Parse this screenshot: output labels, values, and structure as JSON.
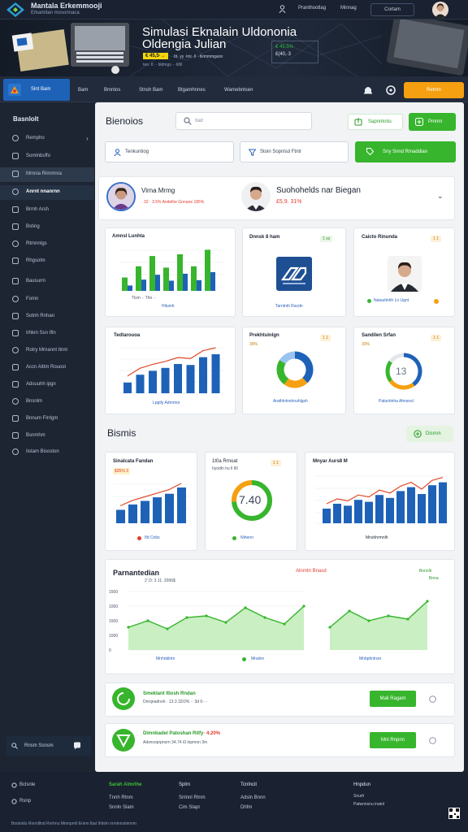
{
  "topbar": {
    "brand": "Mantala Erkemmooji",
    "brand_sub": "Erkamitan mosonnaca",
    "links": [
      "Pranthootlag",
      "Minnag"
    ],
    "search_btn": "Cortam"
  },
  "hero": {
    "title": "Simulasi Eknalain Uldononia Oldengia Julian",
    "tag": "€ 45,5·→",
    "tagline": "Itt· yy ·lmi ·ll ··tlvmmmgann",
    "tagline2": "teo· tl ·· bldmgs ···lilltl",
    "box_line1": "€ 45,5%",
    "box_line2": "£(40,·3"
  },
  "nav": {
    "active_label": "Sint Bam",
    "items": [
      "Bam",
      "Bmntos",
      "Stnsh Bam",
      "Btgamhnnes",
      "Warnebntsen"
    ],
    "cta": "Retnm"
  },
  "sidebar": {
    "title": "Basnlolt",
    "items": [
      "Rempho",
      "Somlnbsffo",
      "Mmnia Rimmnra",
      "Anrnt nnanrnn",
      "Brmh Arsh",
      "Bsting",
      "Rtmnntgs",
      "Rhgsolm",
      "Bausurm",
      "Fomn",
      "Sotnh Rnhan",
      "Irhkm Ssn Ifin",
      "Rotry Mrnannt Itnm",
      "Accn Aittm Rouost",
      "Adsuuhh ipgn",
      "Bnsnlm",
      "Bnnum Flrrlgm",
      "Bsnmhm",
      "Iistam Bisoston"
    ],
    "bottom": "Rnsm Ssnsm"
  },
  "main": {
    "title": "Bienoios",
    "search_placeholder": "Itatr",
    "btn_outline": "Sapnnkntu",
    "btn_green": "Pmnm",
    "field1": "Tenkuntiog",
    "field2": "Stoin Sopnlsd Ftntr",
    "field_green": "Sny Snnd Rmaddian"
  },
  "profile": {
    "name1": "Virna Mrmg",
    "sub1": "· 32 · 3.5%   Andelhe Gnnune   185%",
    "name2": "Suohohelds nar Biegan",
    "sub2": "£5,9. 31%"
  },
  "cards_row1": [
    {
      "title": "Amnsl Lunhta",
      "caption": "Tlsm ·· Tlm ··",
      "sub": "Hilumh"
    },
    {
      "title": "Dnnsk 8 ham",
      "badge": "1 ss",
      "sub": "Tarntnih Racdn"
    },
    {
      "title": "Caicto Rinunda",
      "badge": "1 1",
      "sub": "Natuultnhh Ln Ugnt"
    }
  ],
  "cards_row2": [
    {
      "title": "Tedtarouoa",
      "sub": "Lpgtly Adrnmor"
    },
    {
      "title": "Prekhtuinlgn",
      "badge": "1 1",
      "badge2": "39%",
      "sub": "Arathlnlnnhouhlgsh"
    },
    {
      "title": "Sandilen Srfan",
      "badge": "1 1",
      "badge2": "30%",
      "center": "13",
      "sub": "Patuntinha Ahnsnsl"
    }
  ],
  "section2": {
    "title": "Bismis",
    "btn": "Dismm"
  },
  "cards_row3": [
    {
      "title": "Sinalcata Fandan",
      "badge": "$35% 3",
      "sub": "Ifd Cnbs"
    },
    {
      "title": "1t0a Rrnoat",
      "sub_title": "hyodln hu ll tl0",
      "badge": "1 1",
      "center": "7.40",
      "sub": "Nihenn"
    },
    {
      "title": "Mnyar Aurs8 M",
      "sub": "Mnshhrmnlh"
    }
  ],
  "area_card": {
    "title": "Parnantedian",
    "date": "2’.D: 3  J1.  2006$",
    "legend1": "Alnrntn Bnasd",
    "legend2": "Bnnnlli",
    "legend2b": "Bnna",
    "sub1": "Mnhnblntn",
    "sub2": "Mnslnn",
    "sub3": "Mnbphnlnsn"
  },
  "chart_data": [
    {
      "type": "bar",
      "title": "Amnsl Lunhta",
      "series": [
        {
          "name": "",
          "values": [
            30,
            55,
            78,
            52,
            82,
            55,
            92
          ]
        },
        {
          "name": "",
          "values": [
            20,
            42,
            60,
            38,
            64,
            40,
            70
          ]
        }
      ]
    },
    {
      "type": "bar",
      "title": "Tedtarouoa",
      "values": [
        22,
        38,
        46,
        52,
        60,
        58,
        74,
        80
      ]
    },
    {
      "type": "pie",
      "title": "Prekhtuinlgn",
      "values": [
        38,
        22,
        24,
        16
      ]
    },
    {
      "type": "pie",
      "title": "Sandilen Srfan",
      "values": [
        40,
        25,
        20,
        15
      ]
    },
    {
      "type": "bar",
      "title": "Sinalcata Fandan",
      "values": [
        30,
        42,
        50,
        58,
        66,
        80
      ]
    },
    {
      "type": "pie",
      "title": "1t0a Rrnoat",
      "values": [
        74,
        26
      ]
    },
    {
      "type": "bar",
      "title": "Mnyar Aurs8 M",
      "values": [
        30,
        40,
        36,
        48,
        44,
        58,
        52,
        66,
        74,
        60,
        78,
        84
      ]
    },
    {
      "type": "area",
      "title": "Parnantedian",
      "ylim": [
        0,
        1500
      ],
      "yticks": [
        "1500",
        "1000",
        "1500",
        "1000",
        "0"
      ],
      "values": [
        700,
        900,
        650,
        1000,
        1050,
        850,
        1300,
        1000,
        800,
        1350
      ],
      "values_right": [
        700,
        1200,
        900,
        1050,
        950,
        1500
      ]
    }
  ],
  "list_rows": [
    {
      "title": "Smeklant Itlosh Rndan",
      "sub": "Dnrqeadnoh · 13.3 32/3% ·· 3d 6····",
      "btn": "Mali Ragam"
    },
    {
      "title": "Dimnbadel Patoshan Ritfy",
      "title_extra": "· 4.20%",
      "sub": "Adsnvoprpnsrn 34,74 t3 lopmon 3m",
      "btn": "Mnl Rnpnn"
    }
  ],
  "footer": {
    "col1": [
      "Bclsnle",
      "Rsnp"
    ],
    "col2_head": "Sarah Almrlhe",
    "col2": [
      "Tnnh Rtnm",
      "Snnln Slam"
    ],
    "col3_head": "Splrn",
    "col3": [
      "Snlnnl Rtnm",
      "Cim Slapr"
    ],
    "col4_head": "Tcnlncit",
    "col4": [
      "Adsln Bnnn",
      "Dhfm"
    ],
    "col5_head": "Hnpdun",
    "col5": [
      "Snurh",
      "Patwnnsnu inatnl"
    ],
    "bottom": "Booloidu Rnnnlllnd Rnrhnu Mmnprnll Eninn lbat Ihlnlm nrmlnnstninnm"
  },
  "colors": {
    "accent_blue": "#1e62b8",
    "accent_green": "#37b52d",
    "accent_orange": "#f5a010",
    "red_text": "#e23b2f"
  }
}
